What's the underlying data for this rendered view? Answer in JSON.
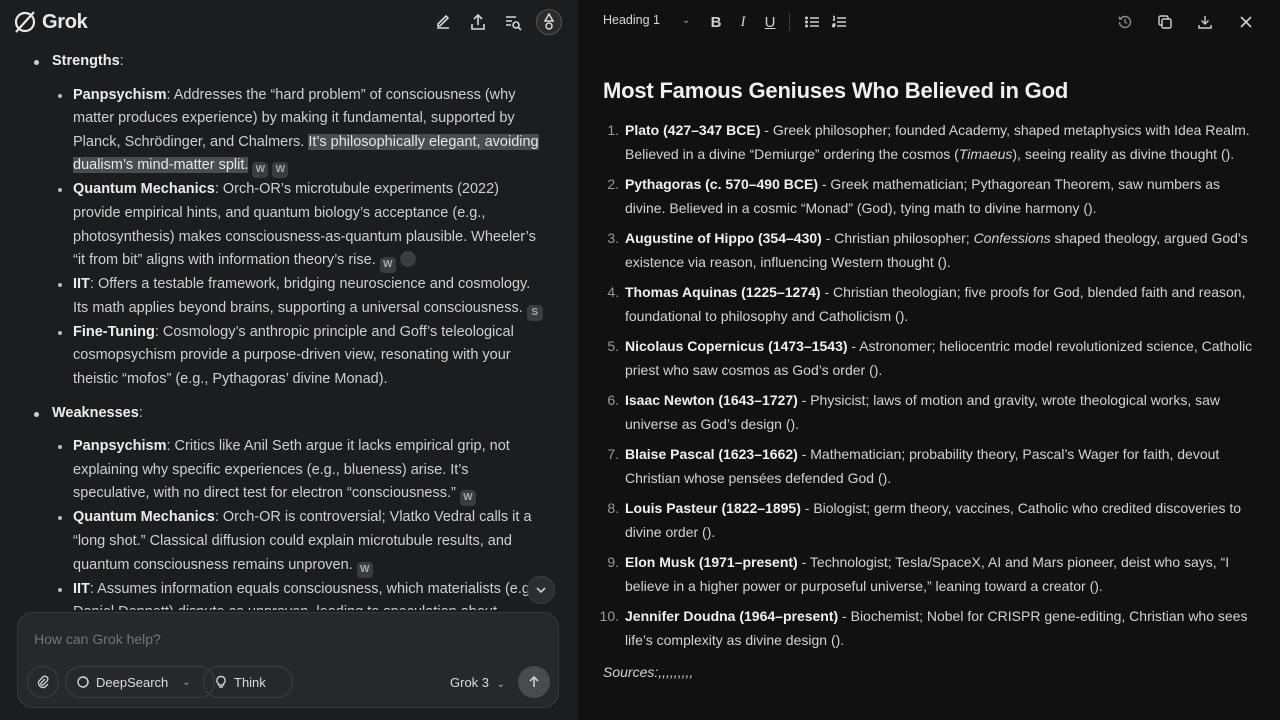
{
  "app": {
    "title": "Grok"
  },
  "chat": {
    "sections": [
      {
        "heading": "Strengths",
        "items": [
          {
            "title": "Panpsychism",
            "text": ": Addresses the “hard problem” of consciousness (why matter produces experience) by making it fundamental, supported by Planck, Schrödinger, and Chalmers. ",
            "highlight": "It’s philosophically elegant, avoiding dualism’s mind-matter split."
          },
          {
            "title": "Quantum Mechanics",
            "text": ": Orch-OR’s microtubule experiments (2022) provide empirical hints, and quantum biology’s acceptance (e.g., photosynthesis) makes consciousness-as-quantum plausible. Wheeler’s “it from bit” aligns with information theory’s rise."
          },
          {
            "title": "IIT",
            "text": ": Offers a testable framework, bridging neuroscience and cosmology. Its math applies beyond brains, supporting a universal consciousness."
          },
          {
            "title": "Fine-Tuning",
            "text": ": Cosmology’s anthropic principle and Goff’s teleological cosmopsychism provide a purpose-driven view, resonating with your theistic “mofos” (e.g., Pythagoras’ divine Monad)."
          }
        ]
      },
      {
        "heading": "Weaknesses",
        "items": [
          {
            "title": "Panpsychism",
            "text": ": Critics like Anil Seth argue it lacks empirical grip, not explaining why specific experiences (e.g., blueness) arise. It’s speculative, with no direct test for electron “consciousness.”"
          },
          {
            "title": "Quantum Mechanics",
            "text": ": Orch-OR is controversial; Vlatko Vedral calls it a “long shot.” Classical diffusion could explain microtubule results, and quantum consciousness remains unproven."
          },
          {
            "title": "IIT",
            "text": ": Assumes information equals consciousness, which materialists (e.g., Daniel Dennett) dispute as unproven, leading to speculation about..."
          }
        ]
      }
    ],
    "citations": {
      "c1": "W",
      "c2": "W",
      "c3": "W",
      "c4": "S",
      "c5": "W",
      "c6": "W"
    }
  },
  "composer": {
    "placeholder": "How can Grok help?",
    "deepsearch_label": "DeepSearch",
    "think_label": "Think",
    "model_label": "Grok 3"
  },
  "editor": {
    "style_label": "Heading 1",
    "title": "Most Famous Geniuses Who Believed in God",
    "entries": [
      {
        "name": "Plato (427–347 BCE)",
        "a": " - Greek philosopher; founded Academy, shaped metaphysics with Idea Realm. Believed in a divine “Demiurge” ordering the cosmos (",
        "em": "Timaeus",
        "b": "), seeing reality as divine thought ()."
      },
      {
        "name": "Pythagoras (c. 570–490 BCE)",
        "a": " - Greek mathematician; Pythagorean Theorem, saw numbers as divine. Believed in a cosmic “Monad” (God), tying math to divine harmony ().",
        "em": "",
        "b": ""
      },
      {
        "name": "Augustine of Hippo (354–430)",
        "a": " - Christian philosopher; ",
        "em": "Confessions",
        "b": " shaped theology, argued God’s existence via reason, influencing Western thought ()."
      },
      {
        "name": "Thomas Aquinas (1225–1274)",
        "a": " - Christian theologian; five proofs for God, blended faith and reason, foundational to philosophy and Catholicism ().",
        "em": "",
        "b": ""
      },
      {
        "name": "Nicolaus Copernicus (1473–1543)",
        "a": " - Astronomer; heliocentric model revolutionized science, Catholic priest who saw cosmos as God’s order ().",
        "em": "",
        "b": ""
      },
      {
        "name": "Isaac Newton (1643–1727)",
        "a": " - Physicist; laws of motion and gravity, wrote theological works, saw universe as God’s design ().",
        "em": "",
        "b": ""
      },
      {
        "name": "Blaise Pascal (1623–1662)",
        "a": " - Mathematician; probability theory, Pascal’s Wager for faith, devout Christian whose pensées defended God ().",
        "em": "",
        "b": ""
      },
      {
        "name": "Louis Pasteur (1822–1895)",
        "a": " - Biologist; germ theory, vaccines, Catholic who credited discoveries to divine order ().",
        "em": "",
        "b": ""
      },
      {
        "name": "Elon Musk (1971–present)",
        "a": " - Technologist; Tesla/SpaceX, AI and Mars pioneer, deist who says, “I believe in a higher power or purposeful universe,” leaning toward a creator ().",
        "em": "",
        "b": ""
      },
      {
        "name": "Jennifer Doudna (1964–present)",
        "a": " - Biochemist; Nobel for CRISPR gene-editing, Christian who sees life’s complexity as divine design ().",
        "em": "",
        "b": ""
      }
    ],
    "numbers": [
      "1.",
      "2.",
      "3.",
      "4.",
      "5.",
      "6.",
      "7.",
      "8.",
      "9.",
      "10."
    ],
    "sources": "Sources:,,,,,,,,,"
  }
}
